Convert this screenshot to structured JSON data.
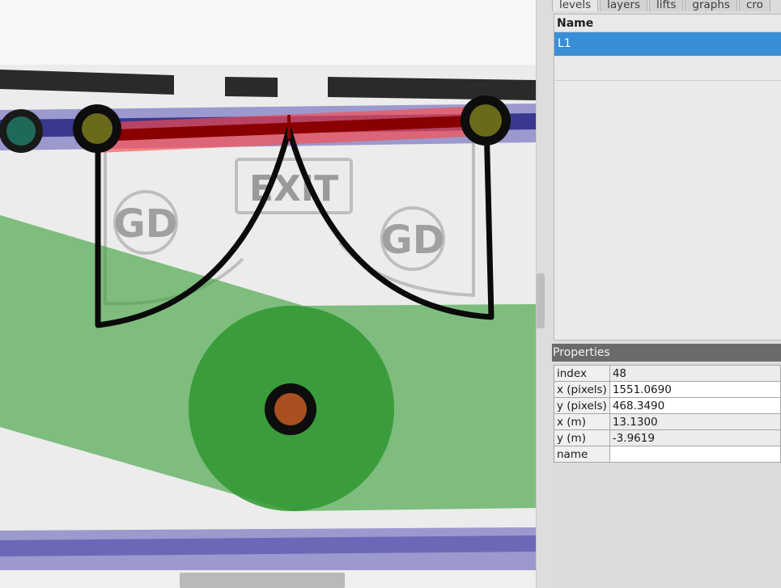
{
  "canvas": {
    "floorplan_text": [
      "EXIT",
      "GD",
      "GD"
    ],
    "colors": {
      "wall": "#3a3a9a",
      "door": "#ff3a3a",
      "fiducial": "#6a6a1a",
      "vertex": "#a85020",
      "zone": "#2ea02e"
    }
  },
  "tabs": [
    "levels",
    "layers",
    "lifts",
    "graphs",
    "cro"
  ],
  "active_tab": "levels",
  "levels": {
    "header": "Name",
    "rows": [
      "L1"
    ],
    "selected": "L1"
  },
  "properties": {
    "title": "Properties",
    "rows": [
      {
        "key": "index",
        "value": "48"
      },
      {
        "key": "x (pixels)",
        "value": "1551.0690"
      },
      {
        "key": "y (pixels)",
        "value": "468.3490"
      },
      {
        "key": "x (m)",
        "value": "13.1300"
      },
      {
        "key": "y (m)",
        "value": "-3.9619"
      },
      {
        "key": "name",
        "value": ""
      }
    ]
  }
}
